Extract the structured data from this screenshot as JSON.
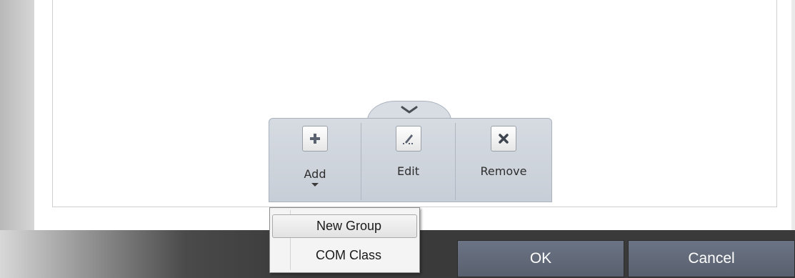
{
  "dialog": {
    "ok_label": "OK",
    "cancel_label": "Cancel"
  },
  "toolbar": {
    "add_label": "Add",
    "edit_label": "Edit",
    "remove_label": "Remove"
  },
  "add_menu": {
    "items": [
      {
        "label": "New Group",
        "selected": true
      },
      {
        "label": "COM Class",
        "selected": false
      }
    ]
  }
}
